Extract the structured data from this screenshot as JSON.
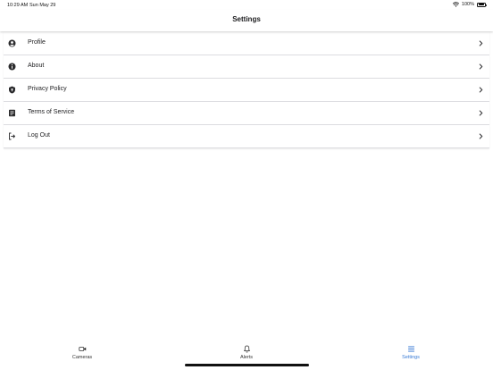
{
  "status_bar": {
    "time": "10:29 AM",
    "date": "Sun May 29",
    "battery": "100%"
  },
  "nav": {
    "title": "Settings"
  },
  "settings": {
    "items": [
      {
        "label": "Profile",
        "icon": "user-circle-icon"
      },
      {
        "label": "About",
        "icon": "info-icon"
      },
      {
        "label": "Privacy Policy",
        "icon": "shield-lock-icon"
      },
      {
        "label": "Terms of Service",
        "icon": "document-icon"
      },
      {
        "label": "Log Out",
        "icon": "logout-icon"
      }
    ]
  },
  "tabs": [
    {
      "label": "Cameras",
      "icon": "video-camera-icon",
      "active": false
    },
    {
      "label": "Alerts",
      "icon": "bell-icon",
      "active": false
    },
    {
      "label": "Settings",
      "icon": "list-icon",
      "active": true
    }
  ],
  "colors": {
    "accent": "#3a7bd5",
    "text": "#1c1c1e",
    "icon": "#2c2c2e",
    "divider": "#dcdce0"
  }
}
